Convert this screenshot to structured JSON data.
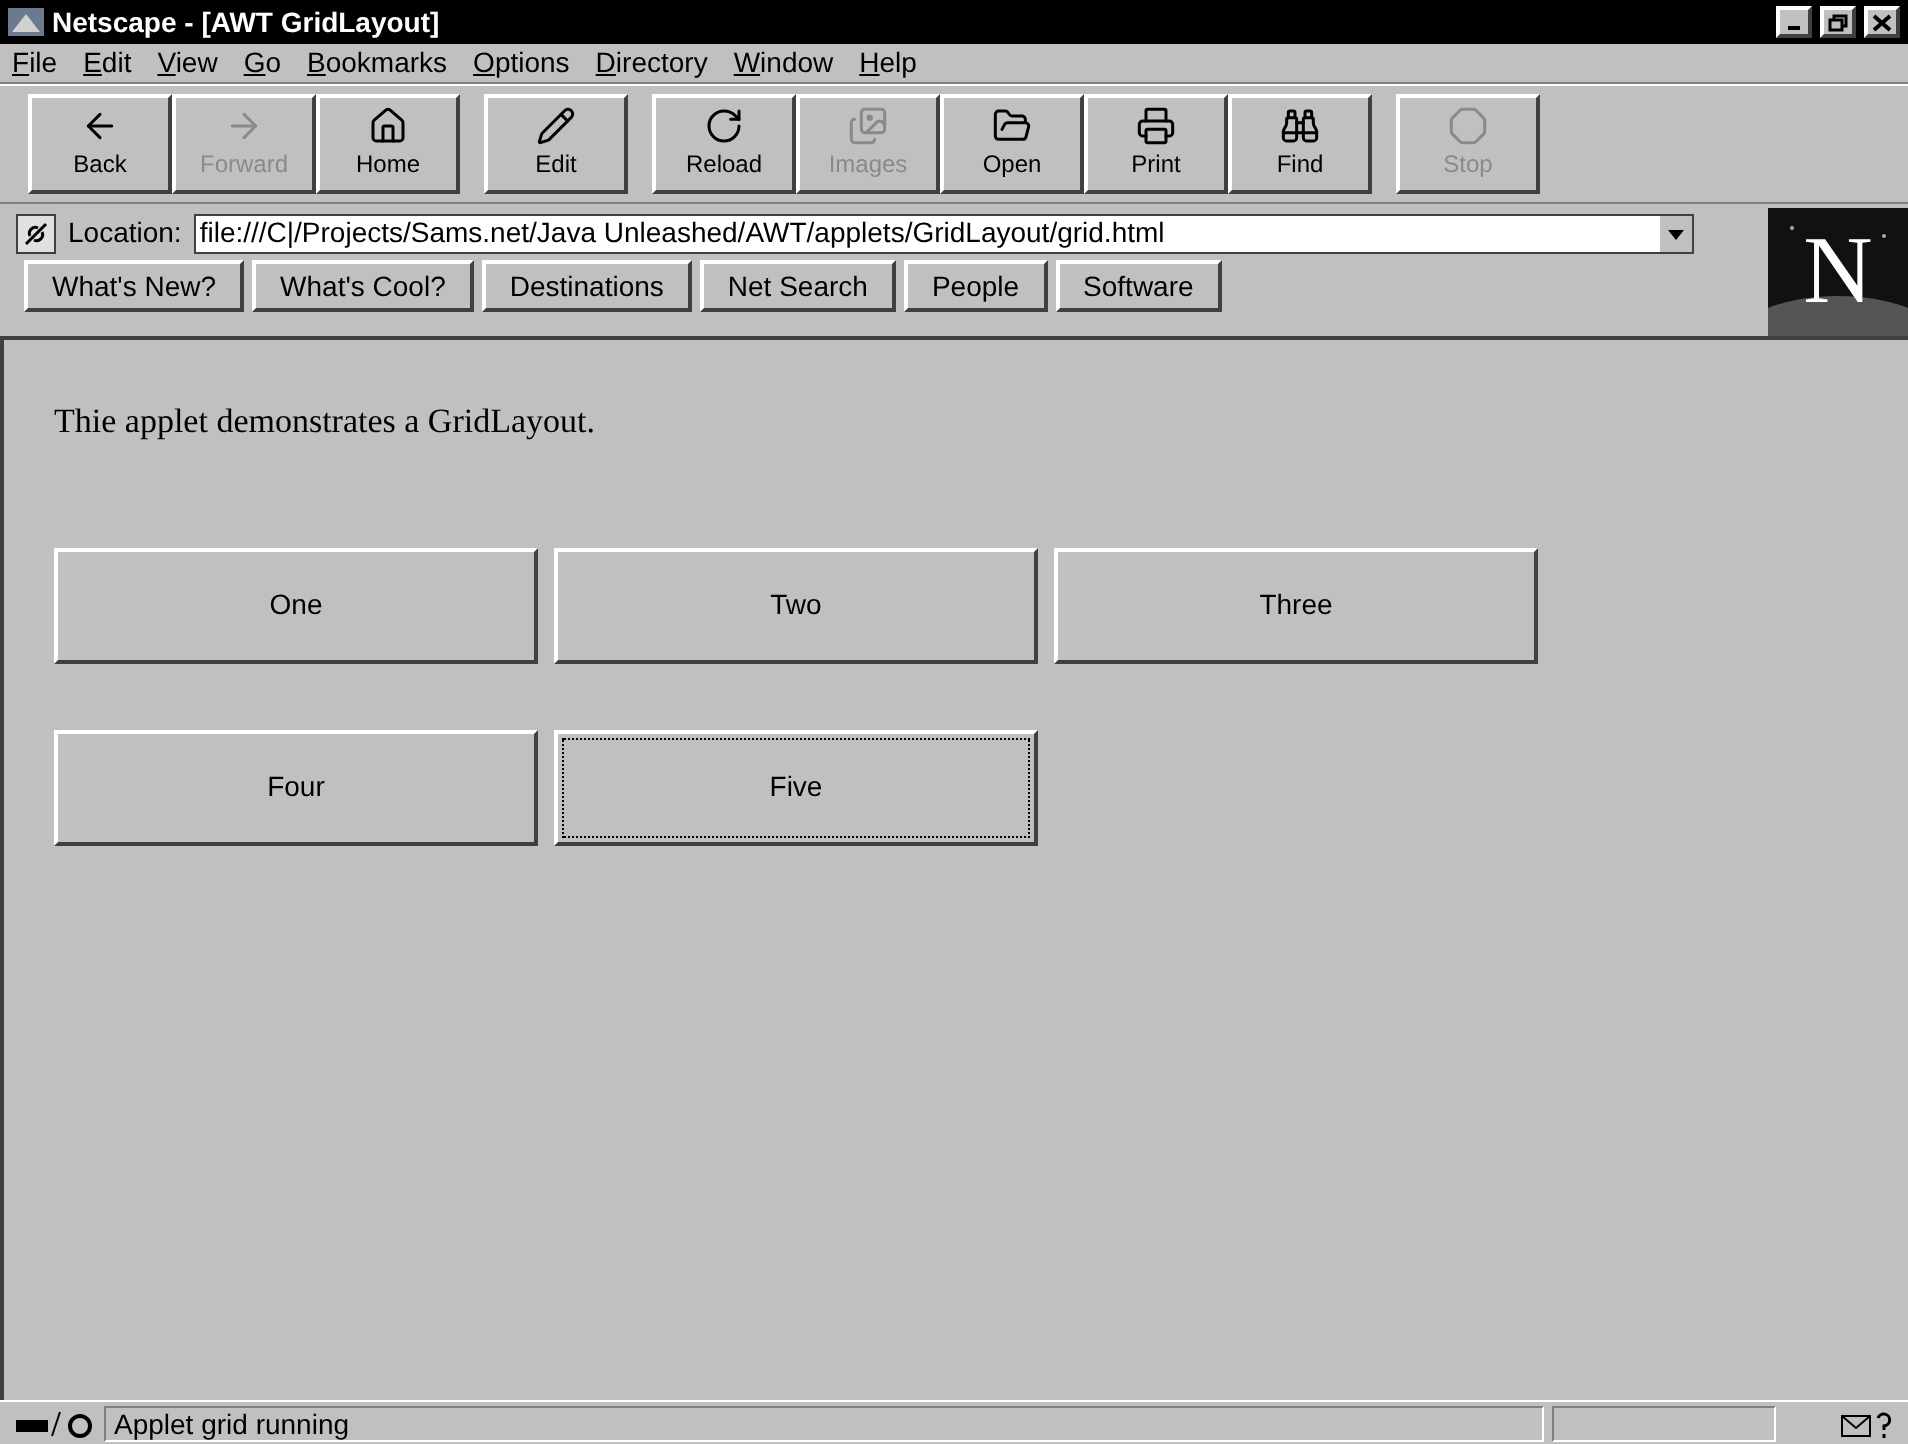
{
  "window": {
    "title": "Netscape - [AWT GridLayout]"
  },
  "menu": [
    "File",
    "Edit",
    "View",
    "Go",
    "Bookmarks",
    "Options",
    "Directory",
    "Window",
    "Help"
  ],
  "toolbar_groups": [
    [
      {
        "kind": "back",
        "label": "Back",
        "disabled": false
      },
      {
        "kind": "forward",
        "label": "Forward",
        "disabled": true
      },
      {
        "kind": "home",
        "label": "Home",
        "disabled": false
      }
    ],
    [
      {
        "kind": "edit",
        "label": "Edit",
        "disabled": false
      }
    ],
    [
      {
        "kind": "reload",
        "label": "Reload",
        "disabled": false
      },
      {
        "kind": "images",
        "label": "Images",
        "disabled": true
      },
      {
        "kind": "open",
        "label": "Open",
        "disabled": false
      },
      {
        "kind": "print",
        "label": "Print",
        "disabled": false
      },
      {
        "kind": "find",
        "label": "Find",
        "disabled": false
      }
    ],
    [
      {
        "kind": "stop",
        "label": "Stop",
        "disabled": true
      }
    ]
  ],
  "location": {
    "label": "Location:",
    "value": "file:///C|/Projects/Sams.net/Java Unleashed/AWT/applets/GridLayout/grid.html"
  },
  "directory_buttons": [
    "What's New?",
    "What's Cool?",
    "Destinations",
    "Net Search",
    "People",
    "Software"
  ],
  "logo": {
    "letter": "N"
  },
  "content": {
    "text": "Thie applet demonstrates a GridLayout.",
    "buttons": [
      {
        "label": "One",
        "focused": false
      },
      {
        "label": "Two",
        "focused": false
      },
      {
        "label": "Three",
        "focused": false
      },
      {
        "label": "Four",
        "focused": false
      },
      {
        "label": "Five",
        "focused": true
      }
    ]
  },
  "status_bar": {
    "text": "Applet grid running"
  }
}
